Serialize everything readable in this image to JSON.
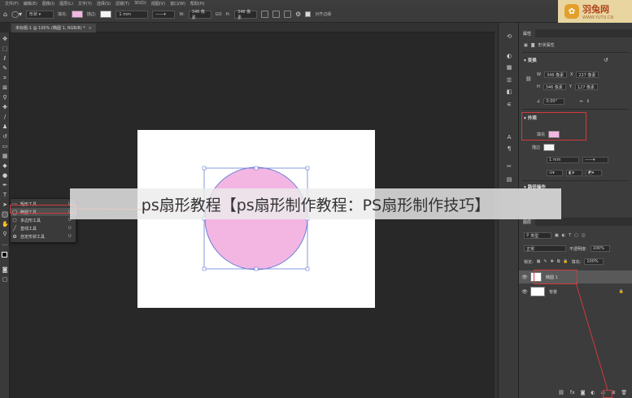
{
  "menubar": {
    "items": [
      "文件(F)",
      "编辑(E)",
      "图像(I)",
      "图层(L)",
      "文字(Y)",
      "选择(S)",
      "滤镜(T)",
      "3D(D)",
      "视图(V)",
      "窗口(W)",
      "帮助(H)"
    ]
  },
  "options": {
    "mode_select": "形状",
    "fill_label": "填充:",
    "stroke_label": "描边:",
    "stroke_width": "1 mm",
    "w_label": "W:",
    "w_value": "346 像素",
    "link_icon": "GO",
    "h_label": "H:",
    "h_value": "346 像素",
    "align_edges_label": "对齐边缘"
  },
  "document_tab": {
    "title": "未标题-1 @ 100% (椭圆 1, RGB/8) *",
    "close": "×"
  },
  "shape_flyout": {
    "items": [
      {
        "label": "矩形工具",
        "key": "U"
      },
      {
        "label": "椭圆工具",
        "key": "U"
      },
      {
        "label": "多边形工具",
        "key": "U"
      },
      {
        "label": "直线工具",
        "key": "U"
      },
      {
        "label": "自定形状工具",
        "key": "U"
      }
    ]
  },
  "properties_panel": {
    "tab_label": "属性",
    "shape_properties_label": "形状属性",
    "transform_section": "变换",
    "w_label": "W",
    "w_value": "346 像素",
    "x_label": "X",
    "x_value": "227 像素",
    "h_label": "H",
    "h_value": "346 像素",
    "y_label": "Y",
    "y_value": "127 像素",
    "angle_value": "0.00°",
    "appearance_section": "外观",
    "fill_label": "填充",
    "stroke_label": "描边",
    "stroke_width": "1 mm",
    "path_ops_section": "路径操作"
  },
  "layers_panel": {
    "tab_label": "图层",
    "filter_kind": "类型",
    "blend_mode": "正常",
    "opacity_label": "不透明度:",
    "opacity_value": "100%",
    "lock_label": "锁定:",
    "fill_label": "填充:",
    "fill_value": "100%",
    "layers": [
      {
        "name": "椭圆 1",
        "selected": true
      },
      {
        "name": "背景",
        "selected": false
      }
    ]
  },
  "overlay_banner": "ps扇形教程【ps扇形制作教程：PS扇形制作技巧】",
  "watermark": {
    "name": "羽兔网",
    "url": "WWW.YUTU.CN"
  },
  "colors": {
    "fill_pink": "#f3b6e2",
    "path_blue": "#6a7fd8",
    "annotation_red": "#d13a3a"
  }
}
